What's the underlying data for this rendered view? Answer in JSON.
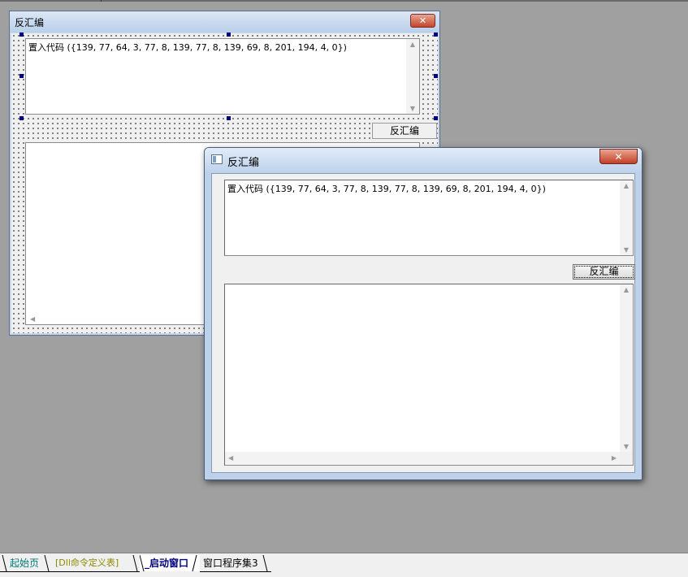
{
  "designer_window": {
    "title": "反汇编",
    "close_glyph": "✕",
    "code_text": "置入代码 ({139, 77, 64, 3, 77, 8, 139, 77, 8, 139, 69, 8, 201, 194, 4, 0})",
    "button_label": "反汇编"
  },
  "run_window": {
    "title": "反汇编",
    "close_glyph": "✕",
    "code_text": "置入代码 ({139, 77, 64, 3, 77, 8, 139, 77, 8, 139, 69, 8, 201, 194, 4, 0})",
    "button_label": "反汇编"
  },
  "scroll_glyphs": {
    "up": "▲",
    "down": "▼",
    "left": "◀",
    "right": "▶"
  },
  "tabs": [
    {
      "label": "起始页",
      "color": "#007878",
      "bold": false
    },
    {
      "label": "[Dll命令定义表]",
      "color": "#8a8a00",
      "bold": false
    },
    {
      "label": "_启动窗口",
      "color": "#000080",
      "bold": true
    },
    {
      "label": "窗口程序集3",
      "color": "#000000",
      "bold": false
    }
  ]
}
